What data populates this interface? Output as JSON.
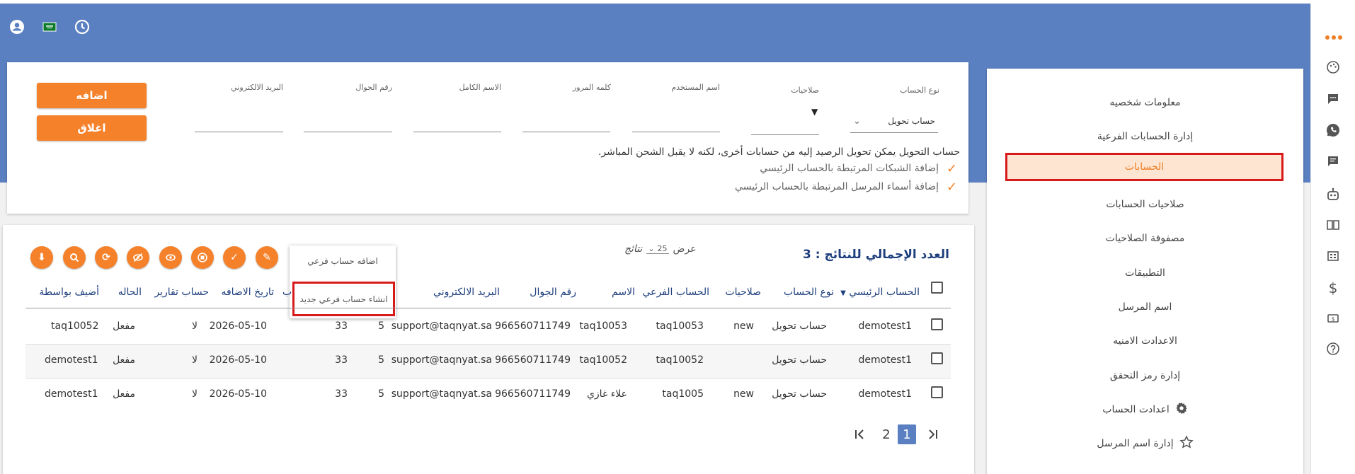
{
  "top_icons": [
    "user-circle-icon",
    "saudi-flag-icon",
    "clock-icon"
  ],
  "colors": {
    "primary": "#5a80c1",
    "accent": "#f5822a",
    "highlight": "#d71a1a"
  },
  "rail_icons": [
    "more-dots-icon",
    "palette-icon",
    "chat-icon",
    "whatsapp-icon",
    "message-icon",
    "robot-icon",
    "book-icon",
    "grid-icon",
    "dollar-icon",
    "money-icon",
    "help-icon"
  ],
  "sidebar": {
    "items": [
      {
        "label": "معلومات شخصيه"
      },
      {
        "label": "إدارة الحسابات الفرعية"
      },
      {
        "label": "الحسابات"
      },
      {
        "label": "صلاحيات الحسابات"
      },
      {
        "label": "مصفوفة الصلاحيات"
      },
      {
        "label": "التطبيقات"
      },
      {
        "label": "اسم المرسل"
      },
      {
        "label": "الاعدادت الامنيه"
      },
      {
        "label": "إدارة رمز التحقق"
      },
      {
        "label": "اعدادت الحساب"
      },
      {
        "label": "إدارة اسم المرسل"
      }
    ]
  },
  "form": {
    "account_type_label": "نوع الحساب",
    "account_type_value": "حساب تحويل",
    "permissions_label": "صلاحيات",
    "username_label": "اسم المستخدم",
    "password_label": "كلمه المرور",
    "fullname_label": "الاسم الكامل",
    "mobile_label": "رقم الجوال",
    "email_label": "البريد الالكتروني",
    "add_button": "اضافه",
    "close_button": "اغلاق",
    "note": "حساب التحويل يمكن تحويل الرصيد إليه من حسابات أخرى، لكنه لا يقبل الشحن المباشر.",
    "checks": [
      "إضافة الشبكات المرتبطة بالحساب الرئيسي",
      "إضافة أسماء المرسل المرتبطة بالحساب الرئيسي"
    ]
  },
  "results": {
    "total_label": "العدد الإجمالي للنتائج : 3",
    "show_label": "عرض",
    "page_size": "25",
    "results_label": "نتائج"
  },
  "action_icons": [
    "download-icon",
    "search-icon",
    "refresh-icon",
    "hide-icon",
    "view-icon",
    "stop-icon",
    "check-icon",
    "edit-icon"
  ],
  "popup": {
    "items": [
      "اضافه حساب فرعي",
      "انشاء حساب فرعي جديد"
    ]
  },
  "table": {
    "headers": [
      "الحساب الرئيسي",
      "نوع الحساب",
      "صلاحيات",
      "الحساب الفرعي",
      "الاسم",
      "رقم الجوال",
      "البريد الالكتروني",
      "تاريخ الاضافه",
      "حساب تقارير",
      "الحاله",
      "أضيف بواسطة"
    ],
    "rows": [
      {
        "main": "demotest1",
        "type": "حساب تحويل",
        "perm": "new",
        "sub": "taq10053",
        "name": "taq10053",
        "mobile": "966560711749",
        "email": "support@taqnyat.sa",
        "c1": "5",
        "c2": "33",
        "date": "2026-05-10",
        "report": "لا",
        "status": "مفعل",
        "by": "taq10052"
      },
      {
        "main": "demotest1",
        "type": "حساب تحويل",
        "perm": "",
        "sub": "taq10052",
        "name": "taq10052",
        "mobile": "966560711749",
        "email": "support@taqnyat.sa",
        "c1": "5",
        "c2": "33",
        "date": "2026-05-10",
        "report": "لا",
        "status": "مفعل",
        "by": "demotest1"
      },
      {
        "main": "demotest1",
        "type": "حساب تحويل",
        "perm": "new",
        "sub": "taq1005",
        "name": "علاء غازي",
        "mobile": "966560711749",
        "email": "support@taqnyat.sa",
        "c1": "5",
        "c2": "33",
        "date": "2026-05-10",
        "report": "لا",
        "status": "مفعل",
        "by": "demotest1"
      }
    ]
  },
  "pagination": {
    "pages": [
      "1",
      "2"
    ],
    "current": "1"
  }
}
